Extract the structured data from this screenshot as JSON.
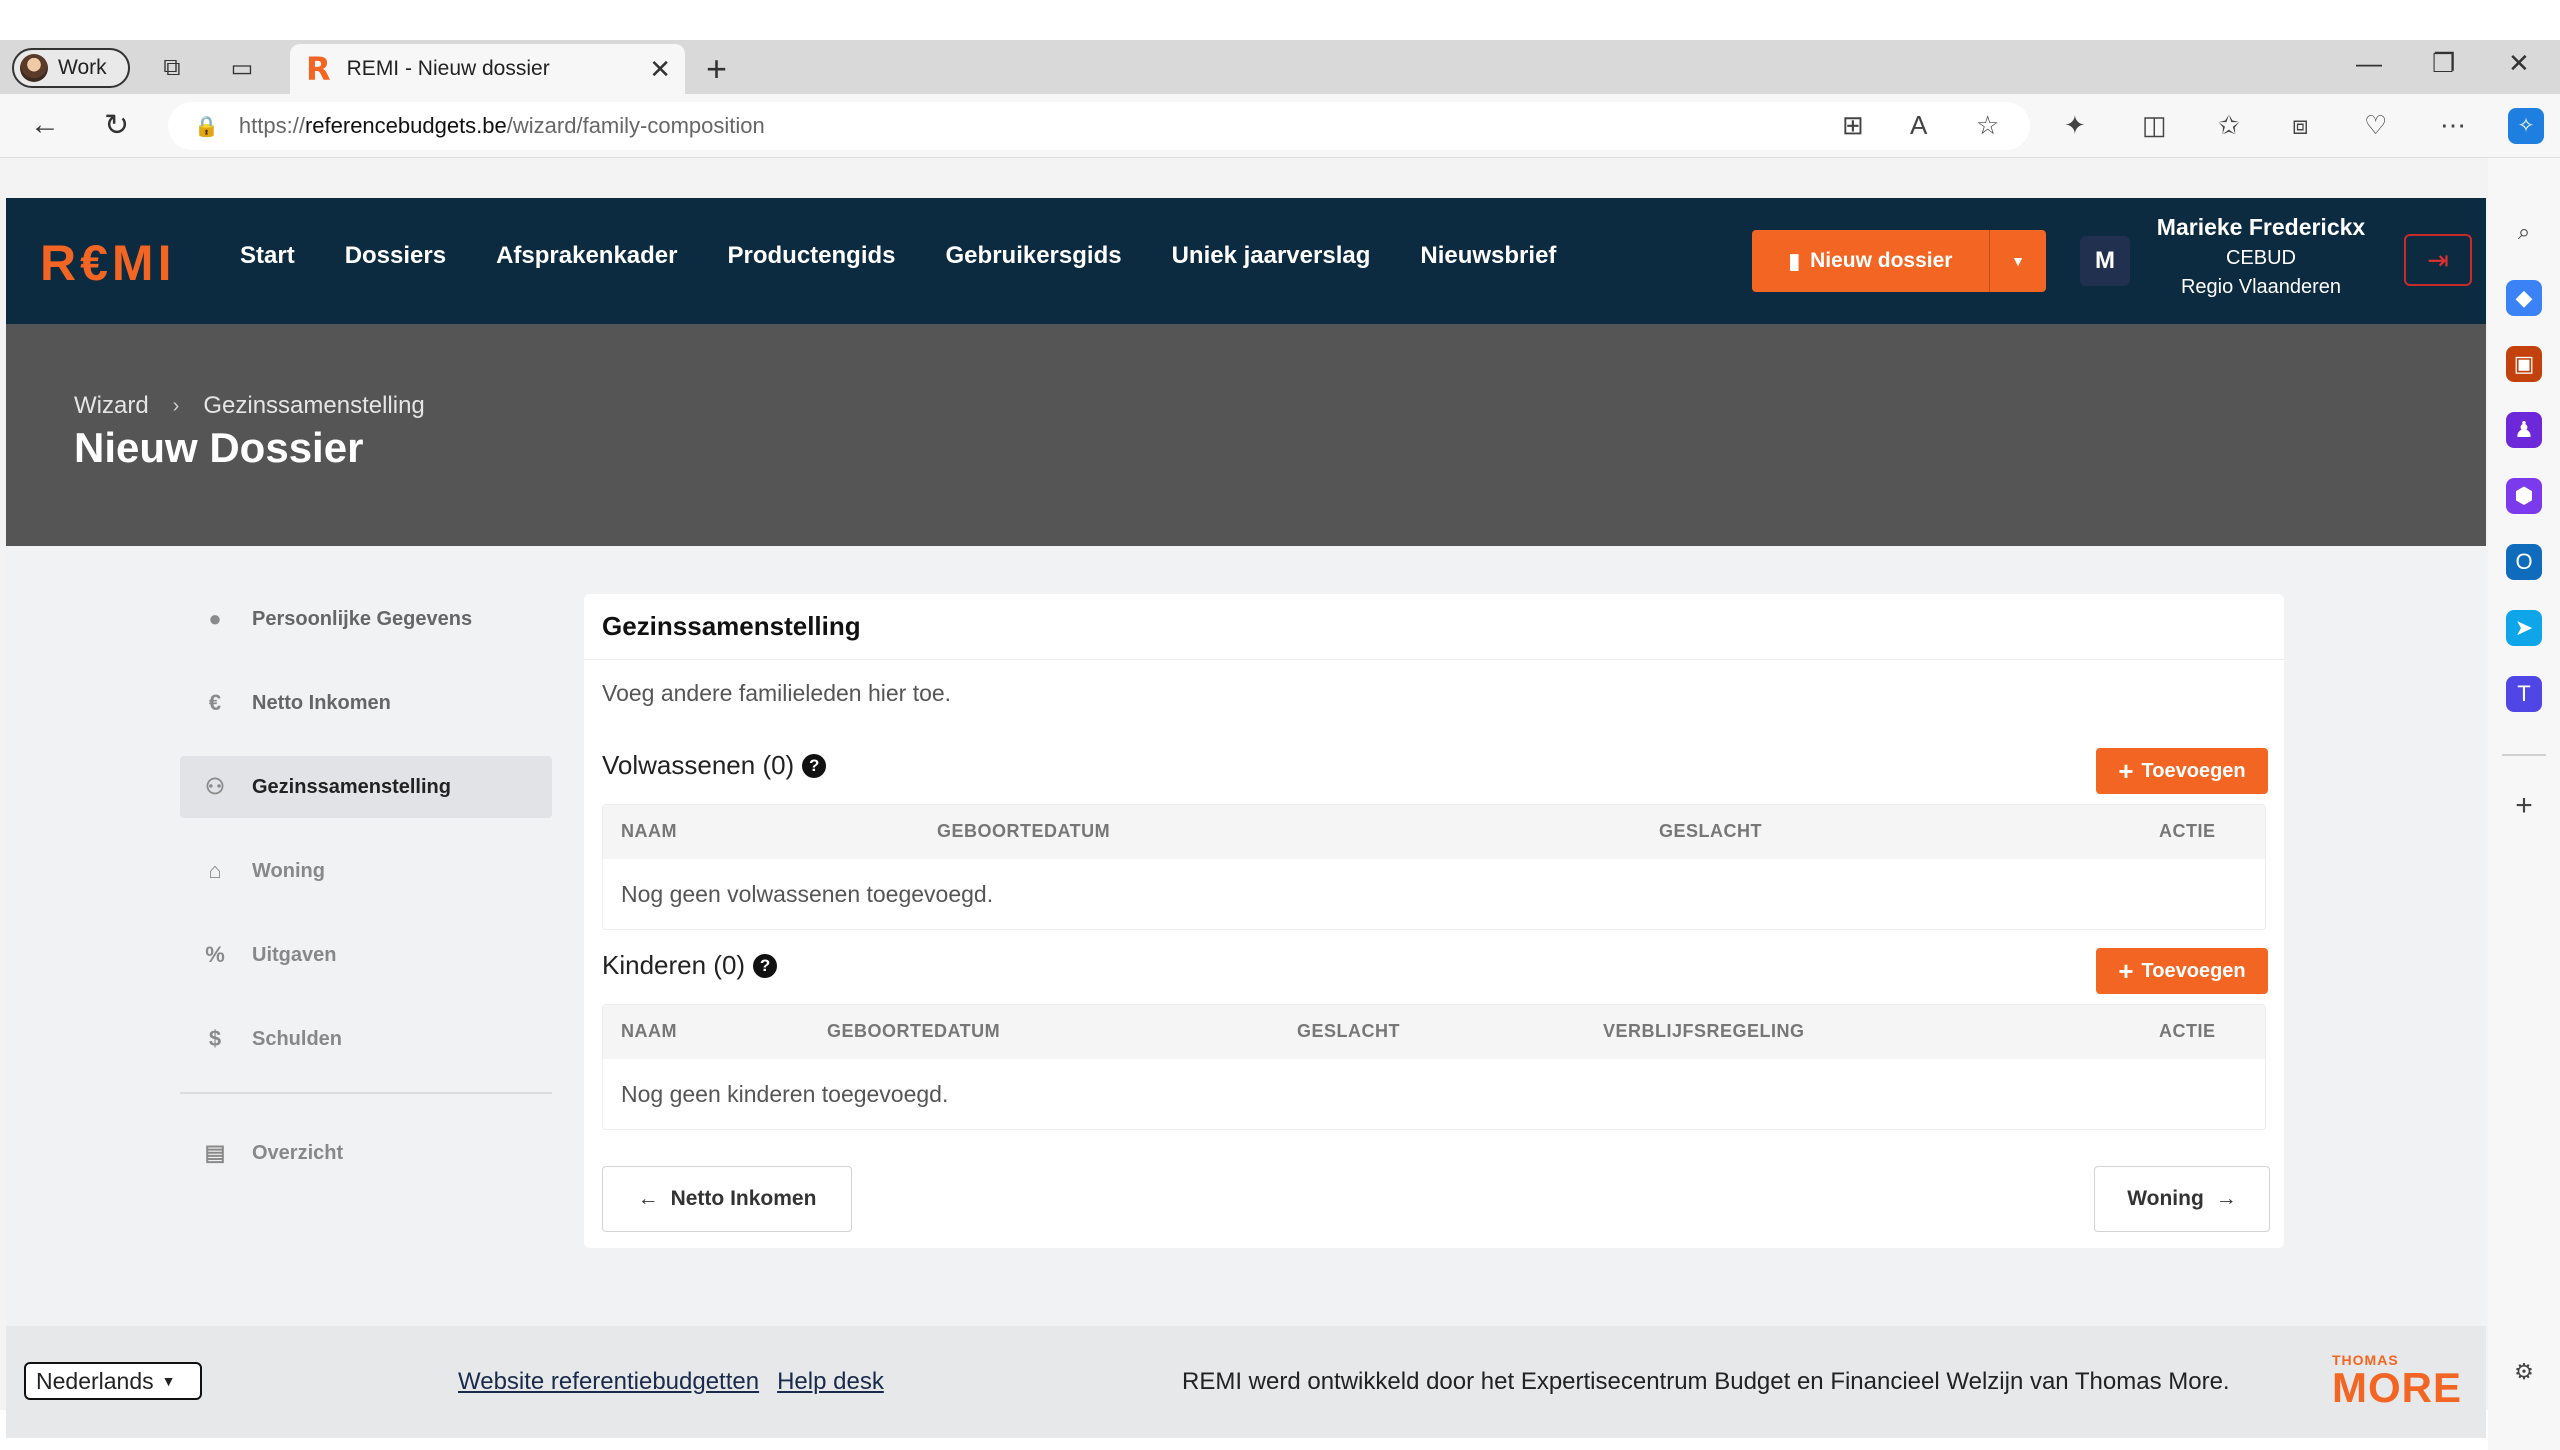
{
  "browser": {
    "profile_label": "Work",
    "tab_title": "REMI - Nieuw dossier",
    "tab_favicon": "R",
    "url_prefix": "https://",
    "url_host": "referencebudgets.be",
    "url_path": "/wizard/family-composition"
  },
  "header": {
    "logo": "R€MI",
    "nav": [
      "Start",
      "Dossiers",
      "Afsprakenkader",
      "Productengids",
      "Gebruikersgids",
      "Uniek jaarverslag",
      "Nieuwsbrief"
    ],
    "new_dossier_label": "Nieuw dossier",
    "avatar_initial": "M",
    "user_name": "Marieke Frederickx",
    "user_org": "CEBUD",
    "user_region": "Regio Vlaanderen"
  },
  "hero": {
    "breadcrumb_root": "Wizard",
    "breadcrumb_current": "Gezinssamenstelling",
    "title": "Nieuw Dossier"
  },
  "steps": [
    {
      "label": "Persoonlijke Gegevens",
      "icon": "person-icon"
    },
    {
      "label": "Netto Inkomen",
      "icon": "euro-icon"
    },
    {
      "label": "Gezinssamenstelling",
      "icon": "family-icon"
    },
    {
      "label": "Woning",
      "icon": "house-icon"
    },
    {
      "label": "Uitgaven",
      "icon": "percent-icon"
    },
    {
      "label": "Schulden",
      "icon": "debt-icon"
    },
    {
      "label": "Overzicht",
      "icon": "document-icon"
    }
  ],
  "main": {
    "card_title": "Gezinssamenstelling",
    "intro": "Voeg andere familieleden hier toe.",
    "adults": {
      "title": "Volwassenen (0)",
      "add_label": "Toevoegen",
      "columns": [
        "NAAM",
        "GEBOORTEDATUM",
        "GESLACHT",
        "ACTIE"
      ],
      "empty": "Nog geen volwassenen toegevoegd."
    },
    "children": {
      "title": "Kinderen (0)",
      "add_label": "Toevoegen",
      "columns": [
        "NAAM",
        "GEBOORTEDATUM",
        "GESLACHT",
        "VERBLIJFSREGELING",
        "ACTIE"
      ],
      "empty": "Nog geen kinderen toegevoegd."
    },
    "prev_label": "Netto Inkomen",
    "next_label": "Woning"
  },
  "footer": {
    "language": "Nederlands",
    "link_website": "Website referentiebudgetten",
    "link_help": "Help desk",
    "credit": "REMI werd ontwikkeld door het Expertisecentrum Budget en Financieel Welzijn van Thomas More.",
    "logo_small": "THOMAS",
    "logo_big": "MORE"
  },
  "colors": {
    "accent": "#f26522",
    "header_bg": "#0c2a40",
    "hero_bg": "#555555"
  }
}
